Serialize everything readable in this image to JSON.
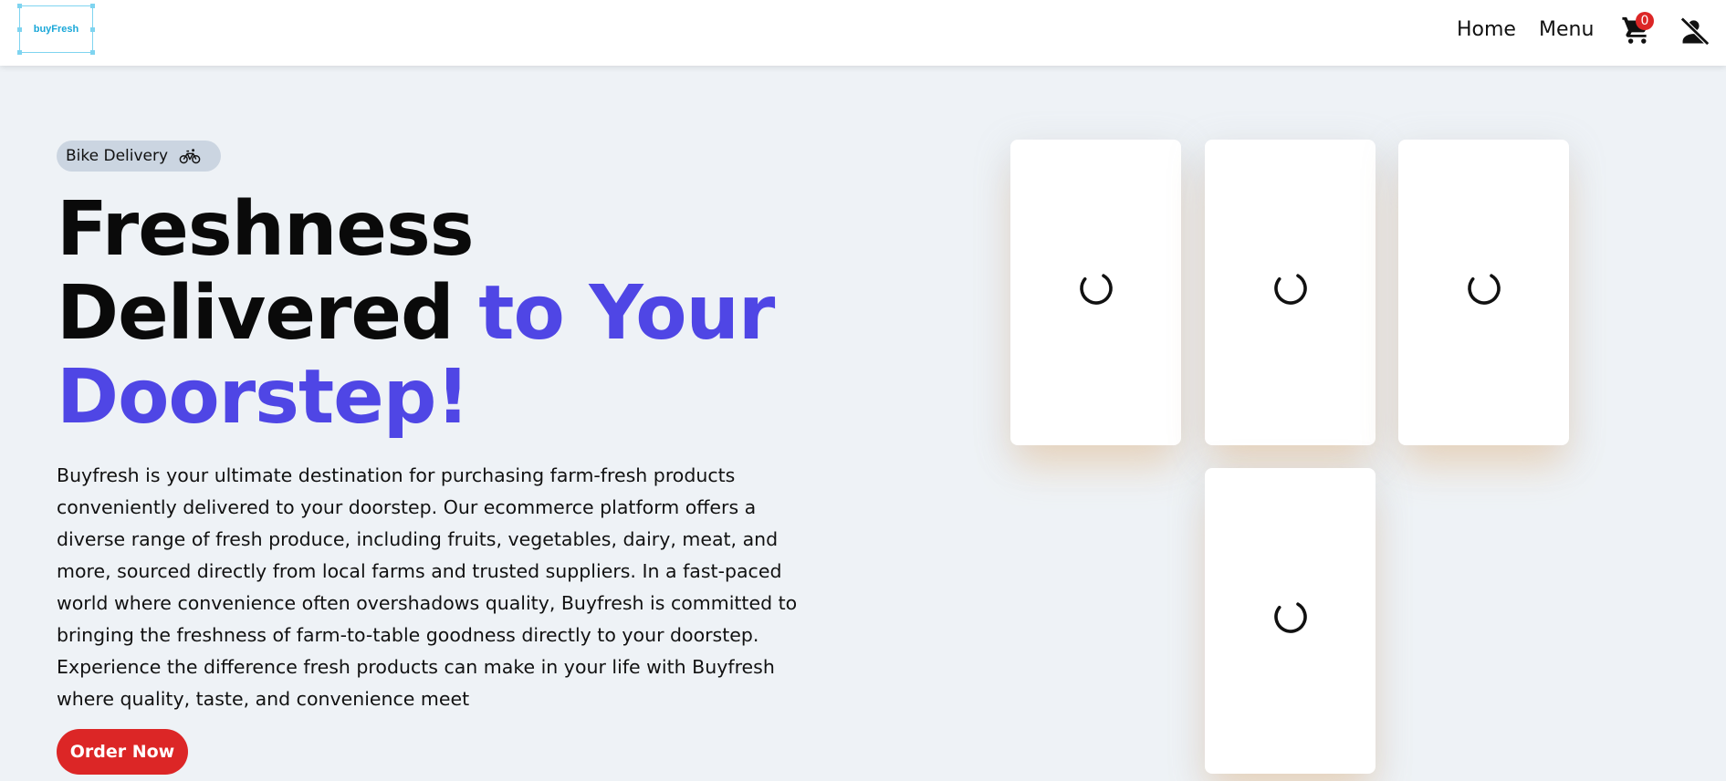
{
  "header": {
    "logo_text": "buyFresh",
    "nav": {
      "home": "Home",
      "menu": "Menu"
    },
    "cart_count": "0",
    "icons": {
      "cart": "cart-icon",
      "user": "user-off-icon"
    }
  },
  "hero": {
    "badge": {
      "label": "Bike Delivery",
      "icon": "bicycle-icon"
    },
    "headline": {
      "line1": "Freshness",
      "line2_dark": "Delivered",
      "line2_accent": "to Your",
      "line3_accent": "Doorstep!"
    },
    "description": "Buyfresh is your ultimate destination for purchasing farm-fresh products conveniently delivered to your doorstep. Our ecommerce platform offers a diverse range of fresh produce, including fruits, vegetables, dairy, meat, and more, sourced directly from local farms and trusted suppliers. In a fast-paced world where convenience often overshadows quality, Buyfresh is committed to bringing the freshness of farm-to-table goodness directly to your doorstep. Experience the difference fresh products can make in your life with Buyfresh where quality, taste, and convenience meet",
    "cta_label": "Order Now"
  },
  "colors": {
    "accent": "#4f46e5",
    "cta": "#dc2626",
    "background": "#eef2f6",
    "badge_bg": "#cbd5e1"
  },
  "cards": [
    {
      "state": "loading",
      "icon": "spinner-icon"
    },
    {
      "state": "loading",
      "icon": "spinner-icon"
    },
    {
      "state": "loading",
      "icon": "spinner-icon"
    },
    {
      "state": "loading",
      "icon": "spinner-icon"
    }
  ]
}
